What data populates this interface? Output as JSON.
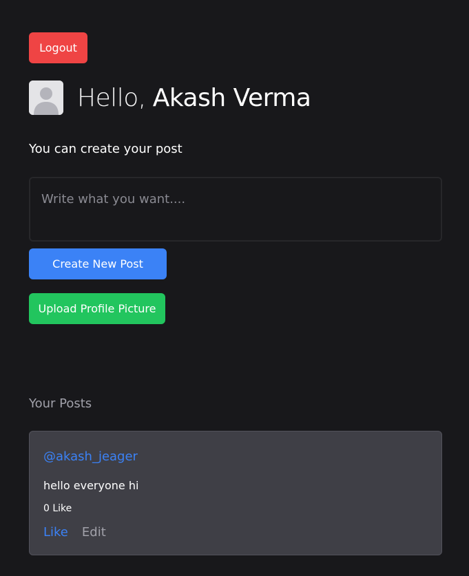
{
  "header": {
    "logout_label": "Logout",
    "greeting_prefix": "Hello,",
    "user_name": "Akash Verma",
    "avatar_icon": "user-silhouette-icon"
  },
  "composer": {
    "caption": "You can create your post",
    "placeholder": "Write what you want....",
    "value": "",
    "create_label": "Create New Post",
    "upload_label": "Upload Profile Picture"
  },
  "posts": {
    "heading": "Your Posts",
    "items": [
      {
        "username": "@akash_jeager",
        "content": "hello everyone hi",
        "likes_text": "0 Like",
        "like_label": "Like",
        "edit_label": "Edit"
      }
    ]
  },
  "colors": {
    "background": "#18181b",
    "logout": "#ef4444",
    "create": "#3b82f6",
    "upload": "#22c55e",
    "card": "#3f3f46",
    "link": "#3b82f6"
  }
}
